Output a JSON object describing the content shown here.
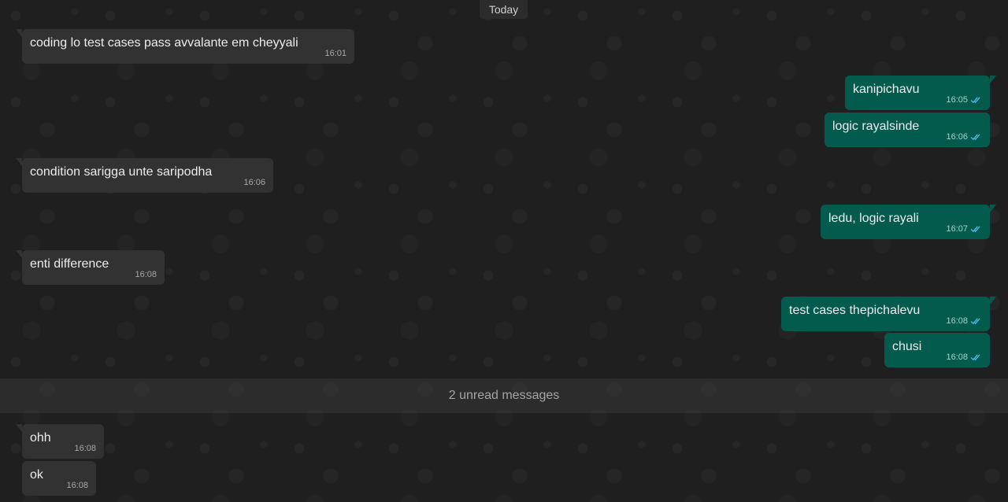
{
  "date_chip": "Today",
  "unread_banner": "2 unread messages",
  "colors": {
    "incoming_bubble": "#323232",
    "outgoing_bubble": "#025b4d",
    "read_tick": "#53bdeb",
    "background": "#1f1f1f"
  },
  "messages": [
    {
      "direction": "in",
      "text": "coding lo test cases pass avvalante em cheyyali",
      "time": "16:01"
    },
    {
      "direction": "out",
      "text": "kanipichavu",
      "time": "16:05",
      "status": "read"
    },
    {
      "direction": "out",
      "text": "logic rayalsinde",
      "time": "16:06",
      "status": "read"
    },
    {
      "direction": "in",
      "text": "condition sarigga unte saripodha",
      "time": "16:06"
    },
    {
      "direction": "out",
      "text": "ledu, logic rayali",
      "time": "16:07",
      "status": "read"
    },
    {
      "direction": "in",
      "text": "enti difference",
      "time": "16:08"
    },
    {
      "direction": "out",
      "text": "test cases thepichalevu",
      "time": "16:08",
      "status": "read"
    },
    {
      "direction": "out",
      "text": "chusi",
      "time": "16:08",
      "status": "read"
    },
    {
      "direction": "in",
      "text": "ohh",
      "time": "16:08"
    },
    {
      "direction": "in",
      "text": "ok",
      "time": "16:08"
    }
  ]
}
